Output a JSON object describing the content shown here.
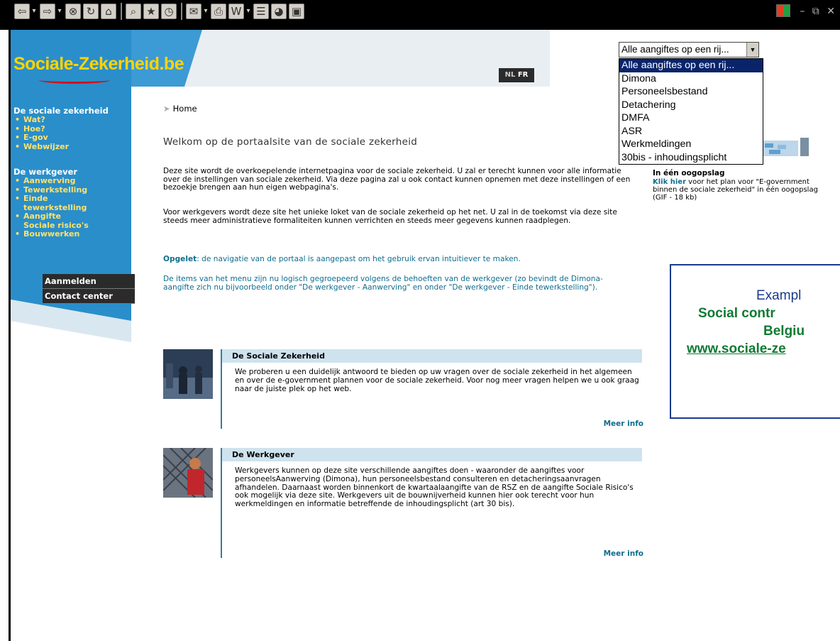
{
  "toolbar": {
    "buttons": [
      {
        "icon": "back-icon",
        "glyph": "⇦"
      },
      {
        "icon": "forward-icon",
        "glyph": "⇨"
      },
      {
        "icon": "stop-icon",
        "glyph": "⊗"
      },
      {
        "icon": "refresh-icon",
        "glyph": "↻"
      },
      {
        "icon": "home-icon",
        "glyph": "⌂"
      },
      {
        "icon": "search-icon",
        "glyph": "⌕"
      },
      {
        "icon": "favorites-icon",
        "glyph": "★"
      },
      {
        "icon": "history-icon",
        "glyph": "◷"
      },
      {
        "icon": "mail-icon",
        "glyph": "✉"
      },
      {
        "icon": "print-icon",
        "glyph": "⎙"
      },
      {
        "icon": "edit-icon",
        "glyph": "W"
      },
      {
        "icon": "discuss-icon",
        "glyph": "☰"
      },
      {
        "icon": "messenger-icon",
        "glyph": "◕"
      },
      {
        "icon": "window-icon",
        "glyph": "▣"
      }
    ],
    "window_controls": "– ⧉ ✕"
  },
  "site": {
    "logo_text": "Sociale-Zekerheid.be",
    "lang_nl": "NL",
    "lang_fr": "FR"
  },
  "sidebar": {
    "section1_title": "De sociale zekerheid",
    "section1_items": [
      "Wat?",
      "Hoe?",
      "E-gov",
      "Webwijzer"
    ],
    "section2_title": "De werkgever",
    "section2_items": [
      "Aanwerving",
      "Tewerkstelling",
      "Einde",
      "Aangifte"
    ],
    "section2_items_cont": {
      "einde": "tewerkstelling",
      "aangifte": "Sociale risico's"
    },
    "section2_last": "Bouwwerken",
    "buttons": [
      "Aanmelden",
      "Contact center"
    ]
  },
  "main": {
    "breadcrumb": "Home",
    "welcome": "Welkom op de portaalsite van de sociale zekerheid",
    "p1": "Deze site wordt de overkoepelende internetpagina voor de sociale zekerheid. U zal er terecht kunnen voor alle informatie over de instellingen van sociale zekerheid. Via deze pagina zal u ook contact kunnen opnemen met deze instellingen of een bezoekje brengen aan hun eigen webpagina's.",
    "p2": "Voor werkgevers wordt deze site het unieke loket van de sociale zekerheid op het net. U zal in de toekomst via deze site steeds meer administratieve formaliteiten kunnen verrichten en steeds meer gegevens kunnen raadplegen.",
    "p3_bold": "Opgelet",
    "p3_rest": ": de navigatie van de portaal is aangepast om het gebruik ervan intuitiever te maken.",
    "p4": "De items van het menu zijn nu logisch gegroepeerd volgens de behoeften van de werkgever (zo bevindt de Dimona-aangifte zich nu bijvoorbeeld onder \"De werkgever - Aanwerving\" en onder \"De werkgever - Einde tewerkstelling\")."
  },
  "boxes": [
    {
      "title": "De Sociale Zekerheid",
      "text": "We proberen u een duidelijk antwoord te bieden op uw vragen over de sociale zekerheid in het algemeen en over de e-government plannen voor de sociale zekerheid. Voor nog meer vragen helpen we u ook graag naar de juiste plek op het web.",
      "more": "Meer info"
    },
    {
      "title": "De Werkgever",
      "text": "Werkgevers kunnen op deze site verschillende aangiftes doen - waaronder de aangiftes voor personeelsAanwerving (Dimona), hun personeelsbestand consulteren en detacheringsaanvragen afhandelen. Daarnaast worden binnenkort de kwartaalaangifte van de RSZ en de aangifte Sociale Risico's ook mogelijk via deze site. Werkgevers uit de bouwnijverheid kunnen hier ook terecht voor hun werkmeldingen en informatie betreffende de inhoudingsplicht (art 30 bis).",
      "more": "Meer info"
    }
  ],
  "promo": {
    "title": "In één oogopslag",
    "link": "Klik hier",
    "text": " voor het plan voor \"E-government binnen de sociale zekerheid\" in één oogopslag (GIF - 18 kb)"
  },
  "dropdown": {
    "selected": "Alle aangiftes op een rij...",
    "options": [
      "Alle aangiftes op een rij...",
      "Dimona",
      "Personeelsbestand",
      "Detachering",
      "DMFA",
      "ASR",
      "Werkmeldingen",
      "30bis - inhoudingsplicht"
    ],
    "highlighted_index": 0
  },
  "annotation": {
    "line1": "Exampl",
    "line2": "Social contr",
    "line3": "Belgiu",
    "line4": "www.sociale-ze"
  },
  "colors": {
    "sidebar_blue": "#2a8ecb",
    "header_blue": "#3c9ad4",
    "logo_yellow": "#ffd400",
    "link_teal": "#0e6e8e",
    "box_head": "#cfe3ef",
    "annotation_border": "#1b3a8c",
    "annotation_green": "#0f7a33"
  }
}
